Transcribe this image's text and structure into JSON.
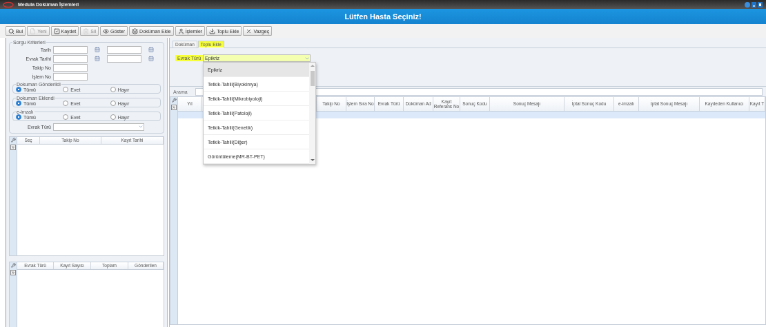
{
  "window": {
    "title": "Medula Doküman İşlemleri"
  },
  "header": {
    "title": "Lütfen Hasta Seçiniz!"
  },
  "toolbar": [
    {
      "label": "Bul",
      "disabled": false
    },
    {
      "label": "Yeni",
      "disabled": true
    },
    {
      "label": "Kaydet",
      "disabled": false
    },
    {
      "label": "Sil",
      "disabled": true
    },
    {
      "label": "Göster",
      "disabled": false
    },
    {
      "label": "Doküman Ekle",
      "disabled": false
    },
    {
      "label": "İşlemler",
      "disabled": false
    },
    {
      "label": "Toplu Ekle",
      "disabled": false
    },
    {
      "label": "Vazgeç",
      "disabled": false
    }
  ],
  "query": {
    "title": "Sorgu Kriterleri",
    "fields": [
      {
        "label": "Tarih",
        "kind": "range"
      },
      {
        "label": "Evrak Tarihi",
        "kind": "range"
      },
      {
        "label": "Takip No",
        "kind": "text"
      },
      {
        "label": "İşlem No",
        "kind": "text"
      }
    ],
    "radio_groups": [
      {
        "title": "Dokuman Gönderildi",
        "options": [
          {
            "label": "Tümü",
            "selected": true
          },
          {
            "label": "Evet",
            "selected": false
          },
          {
            "label": "Hayır",
            "selected": false
          }
        ]
      },
      {
        "title": "Dokuman Eklendi",
        "options": [
          {
            "label": "Tümü",
            "selected": true
          },
          {
            "label": "Evet",
            "selected": false
          },
          {
            "label": "Hayır",
            "selected": false
          }
        ]
      },
      {
        "title": "e-imzalı",
        "options": [
          {
            "label": "Tümü",
            "selected": true
          },
          {
            "label": "Evet",
            "selected": false
          },
          {
            "label": "Hayır",
            "selected": false
          }
        ]
      }
    ],
    "evrak_turu": {
      "label": "Evrak Türü"
    }
  },
  "left_grid": {
    "columns": [
      "Seç",
      "Takip No",
      "Kayıt Tarihi"
    ]
  },
  "summary_grid": {
    "columns": [
      "Evrak Türü",
      "Kayıt Sayısı",
      "Toplam",
      "Gönderilen"
    ]
  },
  "tabs": [
    {
      "label": "Doküman",
      "selected": false,
      "highlighted": false
    },
    {
      "label": "Toplu Ekle",
      "selected": true,
      "highlighted": true
    }
  ],
  "evrak_select": {
    "label": "Evrak Türü",
    "value": "Epikriz",
    "highlighted": true
  },
  "dropdown": {
    "items": [
      {
        "label": "Epikriz",
        "selected": true
      },
      {
        "label": "Tetkik-Tahlil(Biyokimya)",
        "selected": false
      },
      {
        "label": "Tetkik-Tahlil(Mikrobiyoloji)",
        "selected": false
      },
      {
        "label": "Tetkik-Tahlil(Patoloji)",
        "selected": false
      },
      {
        "label": "Tetkik-Tahlil(Genetik)",
        "selected": false
      },
      {
        "label": "Tetkik-Tahlil(Diğer)",
        "selected": false
      },
      {
        "label": "Görüntüleme(MR-BT-PET)",
        "selected": false
      }
    ]
  },
  "search": {
    "label": "Arama"
  },
  "grid": {
    "columns": [
      "Yıl",
      "Takip No",
      "İşlem Sıra No",
      "Evrak Türü",
      "Doküman Ad",
      "Kayıt Referans No",
      "Sonuç Kodu",
      "Sonuç Mesajı",
      "İptal Sonuç Kodu",
      "e-imzalı",
      "İptal Sonuç Mesajı",
      "Kaydeden Kullanıcı",
      "Kayıt T"
    ]
  }
}
